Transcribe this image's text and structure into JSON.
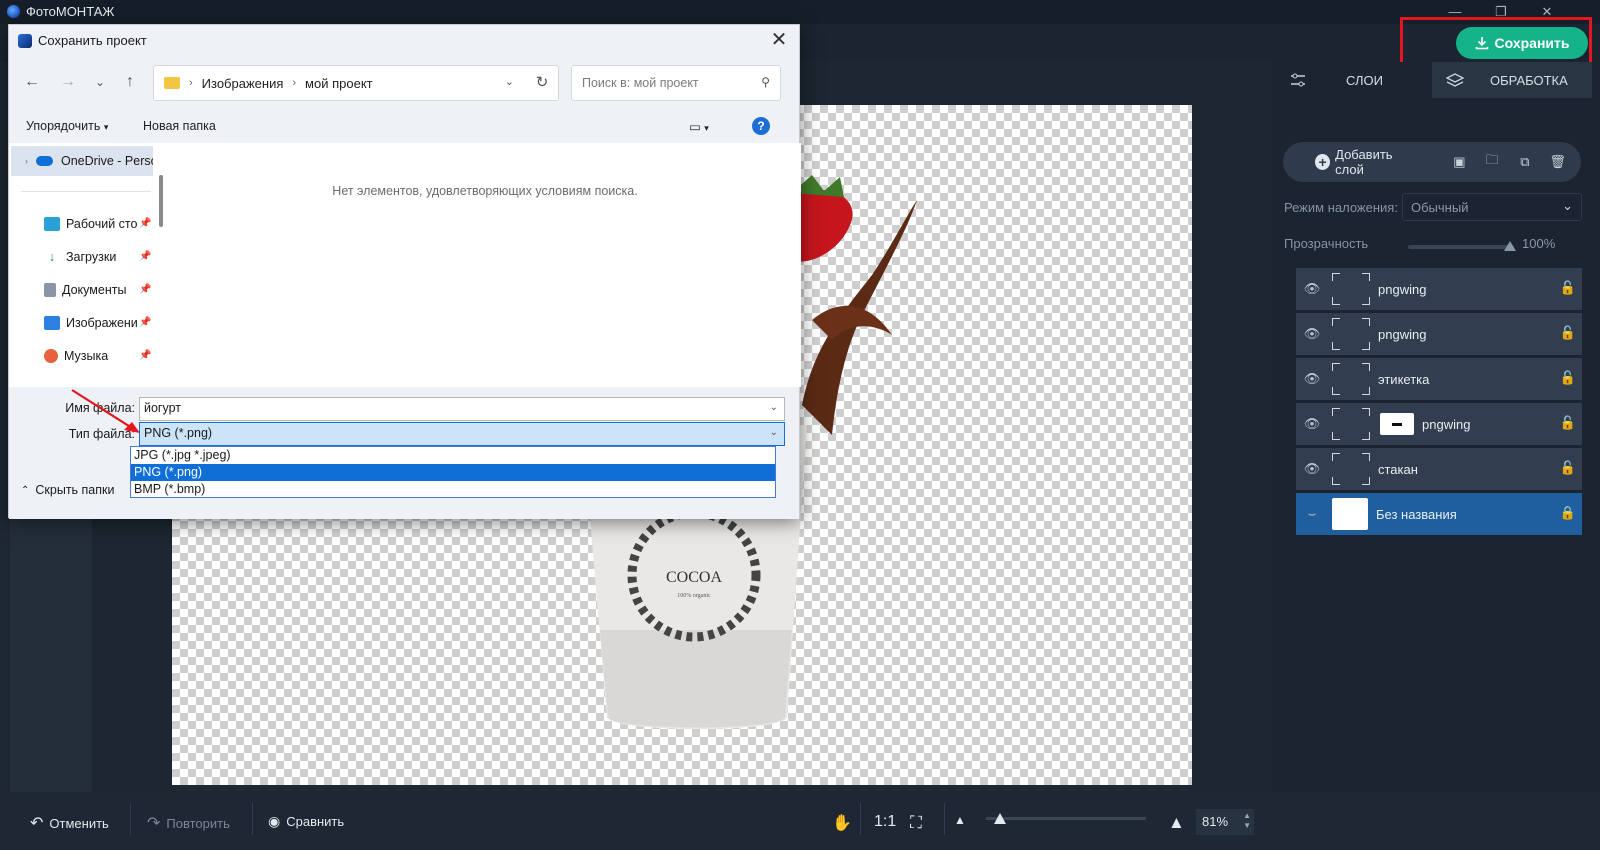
{
  "app": {
    "title": "ФотоМОНТАЖ",
    "save_button": "Сохранить",
    "colors": {
      "accent": "#15b38a",
      "highlight": "#e2161c",
      "selected_layer": "#1f5f9e"
    }
  },
  "dialog": {
    "title": "Сохранить проект",
    "breadcrumb": [
      "Изображения",
      "мой проект"
    ],
    "search_placeholder": "Поиск в: мой проект",
    "organize": "Упорядочить",
    "new_folder": "Новая папка",
    "empty_message": "Нет элементов, удовлетворяющих условиям поиска.",
    "nav": {
      "onedrive": "OneDrive - Perso",
      "items": [
        {
          "label": "Рабочий сто",
          "icon": "desktop-icon"
        },
        {
          "label": "Загрузки",
          "icon": "downloads-icon"
        },
        {
          "label": "Документы",
          "icon": "documents-icon"
        },
        {
          "label": "Изображени",
          "icon": "pictures-icon"
        },
        {
          "label": "Музыка",
          "icon": "music-icon"
        }
      ]
    },
    "filename_label": "Имя файла:",
    "filename_value": "йогурт",
    "filetype_label": "Тип файла:",
    "filetype_value": "PNG (*.png)",
    "filetype_options": [
      "JPG (*.jpg *.jpeg)",
      "PNG (*.png)",
      "BMP (*.bmp)"
    ],
    "hide_folders": "Скрыть папки"
  },
  "panel": {
    "tabs": {
      "layers": "СЛОИ",
      "processing": "ОБРАБОТКА"
    },
    "add_layer": "Добавить слой",
    "blend_label": "Режим наложения:",
    "blend_value": "Обычный",
    "opacity_label": "Прозрачность",
    "opacity_value": "100%",
    "layers": [
      {
        "name": "pngwing",
        "selected": false
      },
      {
        "name": "pngwing",
        "selected": false
      },
      {
        "name": "этикетка",
        "selected": false
      },
      {
        "name": "pngwing",
        "selected": false
      },
      {
        "name": "стакан",
        "selected": false
      },
      {
        "name": "Без названия",
        "selected": true
      }
    ]
  },
  "bottom": {
    "undo": "Отменить",
    "redo": "Повторить",
    "compare": "Сравнить",
    "ratio": "1:1",
    "zoom": "81%"
  },
  "artwork": {
    "cup_text": "COCOA",
    "cup_subtext": "100% organic"
  }
}
